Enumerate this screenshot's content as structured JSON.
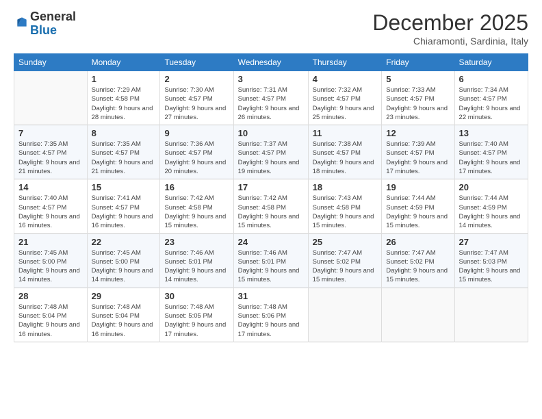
{
  "header": {
    "logo_general": "General",
    "logo_blue": "Blue",
    "month_title": "December 2025",
    "location": "Chiaramonti, Sardinia, Italy"
  },
  "weekdays": [
    "Sunday",
    "Monday",
    "Tuesday",
    "Wednesday",
    "Thursday",
    "Friday",
    "Saturday"
  ],
  "weeks": [
    [
      {
        "day": "",
        "sunrise": "",
        "sunset": "",
        "daylight": ""
      },
      {
        "day": "1",
        "sunrise": "Sunrise: 7:29 AM",
        "sunset": "Sunset: 4:58 PM",
        "daylight": "Daylight: 9 hours and 28 minutes."
      },
      {
        "day": "2",
        "sunrise": "Sunrise: 7:30 AM",
        "sunset": "Sunset: 4:57 PM",
        "daylight": "Daylight: 9 hours and 27 minutes."
      },
      {
        "day": "3",
        "sunrise": "Sunrise: 7:31 AM",
        "sunset": "Sunset: 4:57 PM",
        "daylight": "Daylight: 9 hours and 26 minutes."
      },
      {
        "day": "4",
        "sunrise": "Sunrise: 7:32 AM",
        "sunset": "Sunset: 4:57 PM",
        "daylight": "Daylight: 9 hours and 25 minutes."
      },
      {
        "day": "5",
        "sunrise": "Sunrise: 7:33 AM",
        "sunset": "Sunset: 4:57 PM",
        "daylight": "Daylight: 9 hours and 23 minutes."
      },
      {
        "day": "6",
        "sunrise": "Sunrise: 7:34 AM",
        "sunset": "Sunset: 4:57 PM",
        "daylight": "Daylight: 9 hours and 22 minutes."
      }
    ],
    [
      {
        "day": "7",
        "sunrise": "Sunrise: 7:35 AM",
        "sunset": "Sunset: 4:57 PM",
        "daylight": "Daylight: 9 hours and 21 minutes."
      },
      {
        "day": "8",
        "sunrise": "Sunrise: 7:35 AM",
        "sunset": "Sunset: 4:57 PM",
        "daylight": "Daylight: 9 hours and 21 minutes."
      },
      {
        "day": "9",
        "sunrise": "Sunrise: 7:36 AM",
        "sunset": "Sunset: 4:57 PM",
        "daylight": "Daylight: 9 hours and 20 minutes."
      },
      {
        "day": "10",
        "sunrise": "Sunrise: 7:37 AM",
        "sunset": "Sunset: 4:57 PM",
        "daylight": "Daylight: 9 hours and 19 minutes."
      },
      {
        "day": "11",
        "sunrise": "Sunrise: 7:38 AM",
        "sunset": "Sunset: 4:57 PM",
        "daylight": "Daylight: 9 hours and 18 minutes."
      },
      {
        "day": "12",
        "sunrise": "Sunrise: 7:39 AM",
        "sunset": "Sunset: 4:57 PM",
        "daylight": "Daylight: 9 hours and 17 minutes."
      },
      {
        "day": "13",
        "sunrise": "Sunrise: 7:40 AM",
        "sunset": "Sunset: 4:57 PM",
        "daylight": "Daylight: 9 hours and 17 minutes."
      }
    ],
    [
      {
        "day": "14",
        "sunrise": "Sunrise: 7:40 AM",
        "sunset": "Sunset: 4:57 PM",
        "daylight": "Daylight: 9 hours and 16 minutes."
      },
      {
        "day": "15",
        "sunrise": "Sunrise: 7:41 AM",
        "sunset": "Sunset: 4:57 PM",
        "daylight": "Daylight: 9 hours and 16 minutes."
      },
      {
        "day": "16",
        "sunrise": "Sunrise: 7:42 AM",
        "sunset": "Sunset: 4:58 PM",
        "daylight": "Daylight: 9 hours and 15 minutes."
      },
      {
        "day": "17",
        "sunrise": "Sunrise: 7:42 AM",
        "sunset": "Sunset: 4:58 PM",
        "daylight": "Daylight: 9 hours and 15 minutes."
      },
      {
        "day": "18",
        "sunrise": "Sunrise: 7:43 AM",
        "sunset": "Sunset: 4:58 PM",
        "daylight": "Daylight: 9 hours and 15 minutes."
      },
      {
        "day": "19",
        "sunrise": "Sunrise: 7:44 AM",
        "sunset": "Sunset: 4:59 PM",
        "daylight": "Daylight: 9 hours and 15 minutes."
      },
      {
        "day": "20",
        "sunrise": "Sunrise: 7:44 AM",
        "sunset": "Sunset: 4:59 PM",
        "daylight": "Daylight: 9 hours and 14 minutes."
      }
    ],
    [
      {
        "day": "21",
        "sunrise": "Sunrise: 7:45 AM",
        "sunset": "Sunset: 5:00 PM",
        "daylight": "Daylight: 9 hours and 14 minutes."
      },
      {
        "day": "22",
        "sunrise": "Sunrise: 7:45 AM",
        "sunset": "Sunset: 5:00 PM",
        "daylight": "Daylight: 9 hours and 14 minutes."
      },
      {
        "day": "23",
        "sunrise": "Sunrise: 7:46 AM",
        "sunset": "Sunset: 5:01 PM",
        "daylight": "Daylight: 9 hours and 14 minutes."
      },
      {
        "day": "24",
        "sunrise": "Sunrise: 7:46 AM",
        "sunset": "Sunset: 5:01 PM",
        "daylight": "Daylight: 9 hours and 15 minutes."
      },
      {
        "day": "25",
        "sunrise": "Sunrise: 7:47 AM",
        "sunset": "Sunset: 5:02 PM",
        "daylight": "Daylight: 9 hours and 15 minutes."
      },
      {
        "day": "26",
        "sunrise": "Sunrise: 7:47 AM",
        "sunset": "Sunset: 5:02 PM",
        "daylight": "Daylight: 9 hours and 15 minutes."
      },
      {
        "day": "27",
        "sunrise": "Sunrise: 7:47 AM",
        "sunset": "Sunset: 5:03 PM",
        "daylight": "Daylight: 9 hours and 15 minutes."
      }
    ],
    [
      {
        "day": "28",
        "sunrise": "Sunrise: 7:48 AM",
        "sunset": "Sunset: 5:04 PM",
        "daylight": "Daylight: 9 hours and 16 minutes."
      },
      {
        "day": "29",
        "sunrise": "Sunrise: 7:48 AM",
        "sunset": "Sunset: 5:04 PM",
        "daylight": "Daylight: 9 hours and 16 minutes."
      },
      {
        "day": "30",
        "sunrise": "Sunrise: 7:48 AM",
        "sunset": "Sunset: 5:05 PM",
        "daylight": "Daylight: 9 hours and 17 minutes."
      },
      {
        "day": "31",
        "sunrise": "Sunrise: 7:48 AM",
        "sunset": "Sunset: 5:06 PM",
        "daylight": "Daylight: 9 hours and 17 minutes."
      },
      {
        "day": "",
        "sunrise": "",
        "sunset": "",
        "daylight": ""
      },
      {
        "day": "",
        "sunrise": "",
        "sunset": "",
        "daylight": ""
      },
      {
        "day": "",
        "sunrise": "",
        "sunset": "",
        "daylight": ""
      }
    ]
  ]
}
